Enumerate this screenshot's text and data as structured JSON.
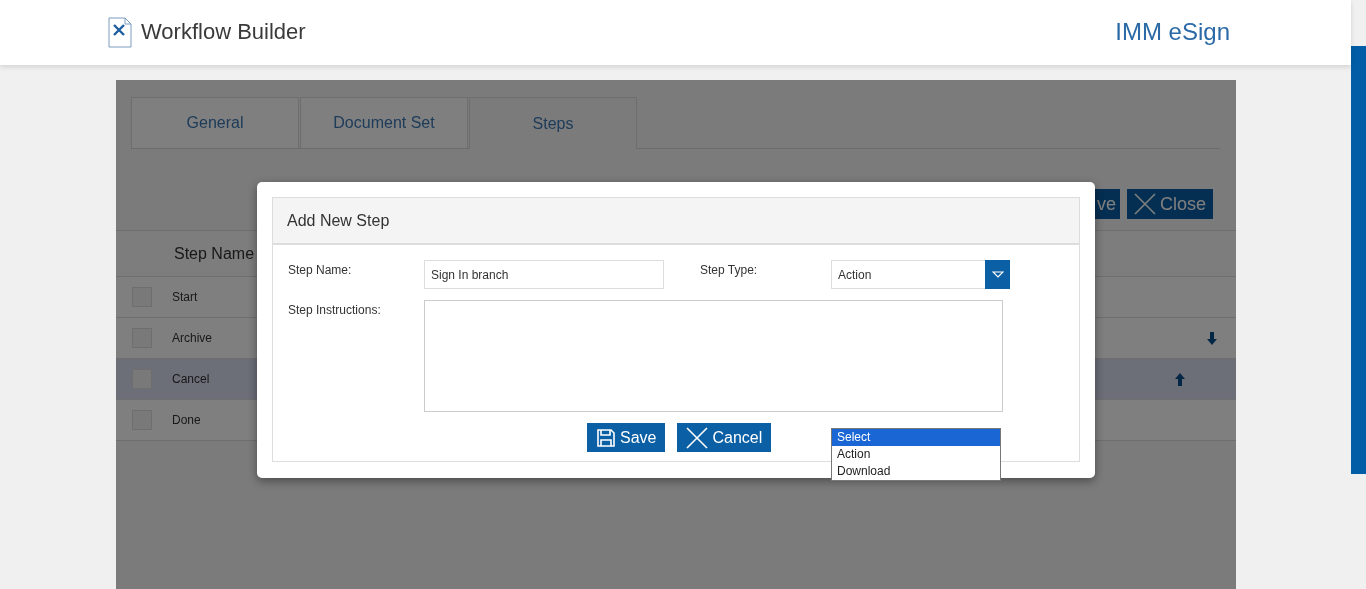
{
  "header": {
    "title": "Workflow Builder",
    "brand": "IMM eSign"
  },
  "tabs": [
    {
      "label": "General",
      "selected": false
    },
    {
      "label": "Document Set",
      "selected": false
    },
    {
      "label": "Steps",
      "selected": true
    }
  ],
  "toolbar": {
    "buttons": [
      {
        "label": "ve",
        "kind": "save"
      },
      {
        "label": "Close",
        "kind": "close"
      }
    ]
  },
  "table": {
    "columns": [
      "Step Name"
    ],
    "rows": [
      {
        "name": "Start",
        "selected": false,
        "checked": false,
        "move_up": false,
        "move_down": false
      },
      {
        "name": "Archive",
        "selected": false,
        "checked": false,
        "move_up": false,
        "move_down": true
      },
      {
        "name": "Cancel",
        "selected": true,
        "checked": false,
        "move_up": true,
        "move_down": false
      },
      {
        "name": "Done",
        "selected": false,
        "checked": false,
        "move_up": false,
        "move_down": false
      }
    ]
  },
  "dialog": {
    "title": "Add New Step",
    "step_name": {
      "label": "Step Name:",
      "value": "Sign In branch"
    },
    "step_type": {
      "label": "Step Type:",
      "value": "Action"
    },
    "instructions": {
      "label": "Step Instructions:"
    },
    "buttons": [
      {
        "label": "Save",
        "kind": "save"
      },
      {
        "label": "Cancel",
        "kind": "cancel"
      }
    ],
    "type_options": [
      {
        "label": "Select",
        "selected": true
      },
      {
        "label": "Action",
        "selected": false
      },
      {
        "label": "Download",
        "selected": false
      }
    ]
  }
}
